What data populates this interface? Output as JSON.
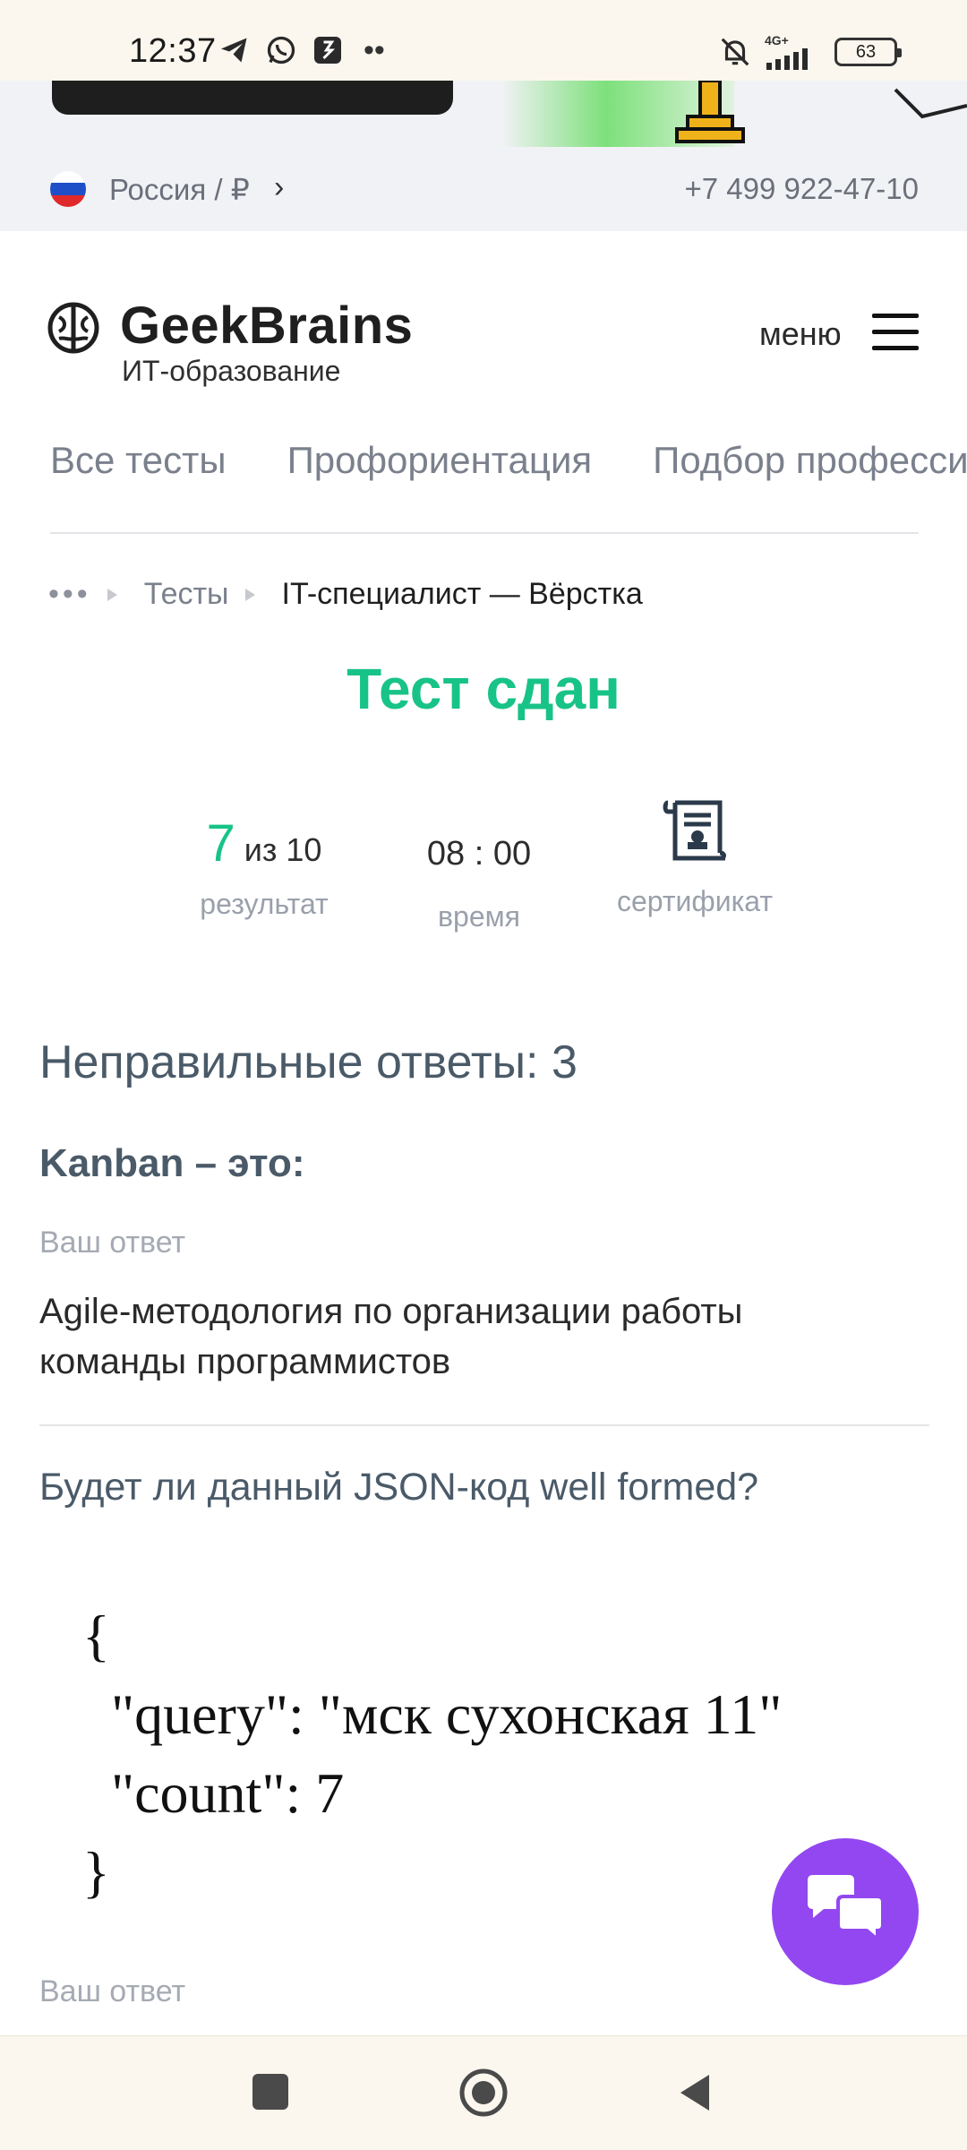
{
  "status_bar": {
    "time": "12:37",
    "network": "4G+",
    "battery": "63"
  },
  "region": {
    "label": "Россия / ₽",
    "phone": "+7 499 922-47-10"
  },
  "header": {
    "logo_name": "GeekBrains",
    "logo_subtitle": "ИТ-образование",
    "menu_label": "меню"
  },
  "tabs": [
    {
      "label": "Все тесты"
    },
    {
      "label": "Профориентация"
    },
    {
      "label": "Подбор профессии"
    }
  ],
  "breadcrumb": {
    "dots": "•••",
    "link": "Тесты",
    "current": "IT-специалист — Вёрстка"
  },
  "result": {
    "title": "Тест сдан",
    "score_value": "7",
    "score_total": "из 10",
    "score_label": "результат",
    "time_value": "08 : 00",
    "time_label": "время",
    "certificate_label": "сертификат"
  },
  "wrong_answers": {
    "title": "Неправильные ответы: 3",
    "questions": [
      {
        "question": "Kanban – это:",
        "your_answer_label": "Ваш ответ",
        "answer": "Agile-методология по организации работы команды программистов"
      },
      {
        "question": "Будет ли данный JSON-код well formed?",
        "code_lines": [
          "{",
          "  \"query\": \"мск сухонская 11\"",
          "  \"count\": 7",
          "}"
        ],
        "your_answer_label": "Ваш ответ"
      }
    ]
  },
  "colors": {
    "accent_green": "#18c387",
    "chat_purple": "#9247f0",
    "heading_slate": "#4a5a68"
  },
  "icons": {
    "chat_button": "chat-bubbles-icon",
    "certificate": "certificate-scroll-icon",
    "menu": "hamburger-icon"
  }
}
